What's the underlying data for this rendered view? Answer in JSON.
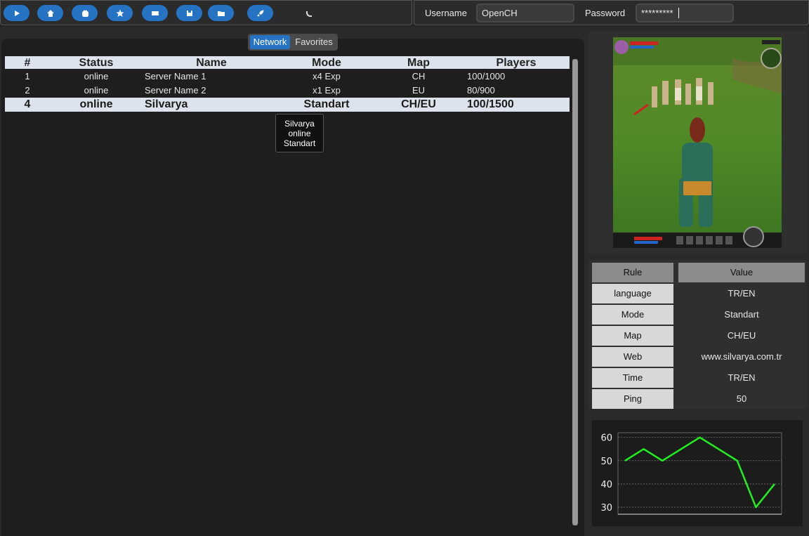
{
  "toolbar": {
    "buttons": [
      "play-icon",
      "home-icon",
      "hand-icon",
      "star-icon",
      "ticket-icon",
      "save-icon",
      "folder-icon",
      "rocket-icon"
    ],
    "accent": "#2673c4"
  },
  "login": {
    "username_label": "Username",
    "username_value": "OpenCH",
    "password_label": "Password",
    "password_value": "*********"
  },
  "tabs": {
    "network": "Network",
    "favorites": "Favorites"
  },
  "table": {
    "headers": {
      "num": "#",
      "status": "Status",
      "name": "Name",
      "mode": "Mode",
      "map": "Map",
      "players": "Players"
    },
    "rows": [
      {
        "num": "1",
        "status": "online",
        "name": "Server Name 1",
        "mode": "x4 Exp",
        "map": "CH",
        "players": "100/1000"
      },
      {
        "num": "2",
        "status": "online",
        "name": "Server Name 2",
        "mode": "x1 Exp",
        "map": "EU",
        "players": "80/900"
      },
      {
        "num": "4",
        "status": "online",
        "name": "Silvarya",
        "mode": "Standart",
        "map": "CH/EU",
        "players": "100/1500"
      }
    ]
  },
  "tooltip": {
    "line1": "Silvarya",
    "line2": "online",
    "line3": "Standart"
  },
  "rules": {
    "header_rule": "Rule",
    "header_value": "Value",
    "items": [
      {
        "key": "language",
        "value": "TR/EN"
      },
      {
        "key": "Mode",
        "value": "Standart"
      },
      {
        "key": "Map",
        "value": "CH/EU"
      },
      {
        "key": "Web",
        "value": "www.silvarya.com.tr"
      },
      {
        "key": "Time",
        "value": "TR/EN"
      },
      {
        "key": "Ping",
        "value": "50"
      }
    ]
  },
  "chart_data": {
    "type": "line",
    "title": "",
    "xlabel": "",
    "ylabel": "",
    "yticks": [
      "60",
      "50",
      "40",
      "30"
    ],
    "ylim": [
      27,
      62
    ],
    "x": [
      0,
      1,
      2,
      3,
      4,
      5,
      6,
      7,
      8
    ],
    "series": [
      {
        "values": [
          50,
          55,
          50,
          55,
          60,
          55,
          50,
          30,
          40
        ],
        "color": "#22ee22"
      }
    ],
    "grid": true
  }
}
